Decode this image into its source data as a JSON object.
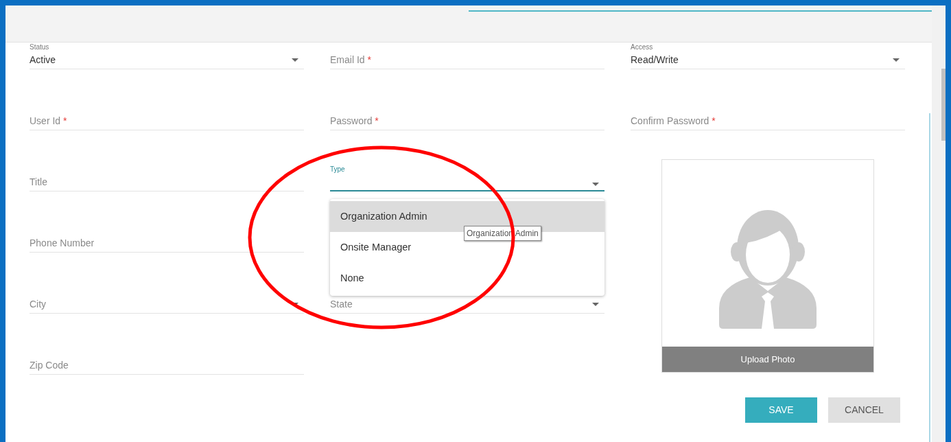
{
  "columns": [
    [
      {
        "kind": "select",
        "label": "Status",
        "value": "Active"
      },
      {
        "kind": "text",
        "placeholder": "User Id",
        "required_mark": "*"
      },
      {
        "kind": "text",
        "placeholder": "Title"
      },
      {
        "kind": "text",
        "placeholder": "Phone Number"
      },
      {
        "kind": "select",
        "placeholder": "City"
      },
      {
        "kind": "text",
        "placeholder": "Zip Code"
      }
    ],
    [
      {
        "kind": "text",
        "placeholder": "Email Id",
        "required_mark": "*"
      },
      {
        "kind": "text",
        "placeholder": "Password",
        "required_mark": "*"
      },
      {
        "kind": "select",
        "label": "Type",
        "focused": true,
        "menu": [
          {
            "label": "Organization Admin",
            "highlighted": true
          },
          {
            "label": "Onsite Manager",
            "highlighted": false
          },
          {
            "label": "None",
            "highlighted": false
          }
        ]
      },
      {
        "kind": "hidden"
      },
      {
        "kind": "select",
        "placeholder": "State"
      }
    ],
    [
      {
        "kind": "select",
        "label": "Access",
        "value": "Read/Write"
      },
      {
        "kind": "text",
        "placeholder": "Confirm Password",
        "required_mark": "*"
      }
    ]
  ],
  "tooltip": "Organization Admin",
  "photo": {
    "button": "Upload Photo"
  },
  "buttons": [
    {
      "label": "SAVE",
      "kind": "primary"
    },
    {
      "label": "CANCEL",
      "kind": "secondary"
    }
  ]
}
